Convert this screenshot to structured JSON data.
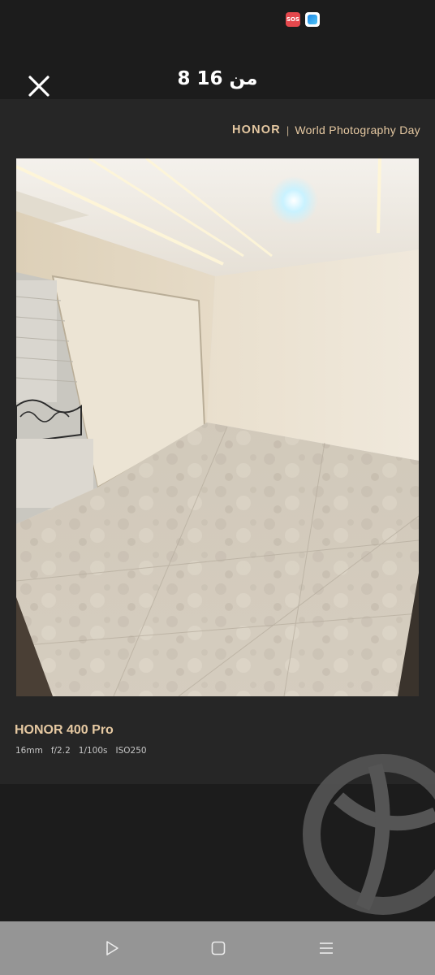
{
  "status_bar": {
    "sos_label": "SOS",
    "sos_color": "#e5484d",
    "app_icon": "app-notification-icon"
  },
  "header": {
    "counter": "8 من 16",
    "close_icon": "close-icon"
  },
  "watermark": {
    "brand": "HONOR",
    "separator": "|",
    "event": "World Photography Day",
    "color": "#e6c9a2"
  },
  "photo": {
    "description_icon": "listing-photo"
  },
  "exif": {
    "device": "HONOR 400 Pro",
    "focal_length": "16mm",
    "aperture": "f/2.2",
    "shutter": "1/100s",
    "iso": "ISO250"
  },
  "nav": {
    "back_icon": "back-triangle-icon",
    "home_icon": "home-square-icon",
    "recents_icon": "recents-menu-icon"
  }
}
